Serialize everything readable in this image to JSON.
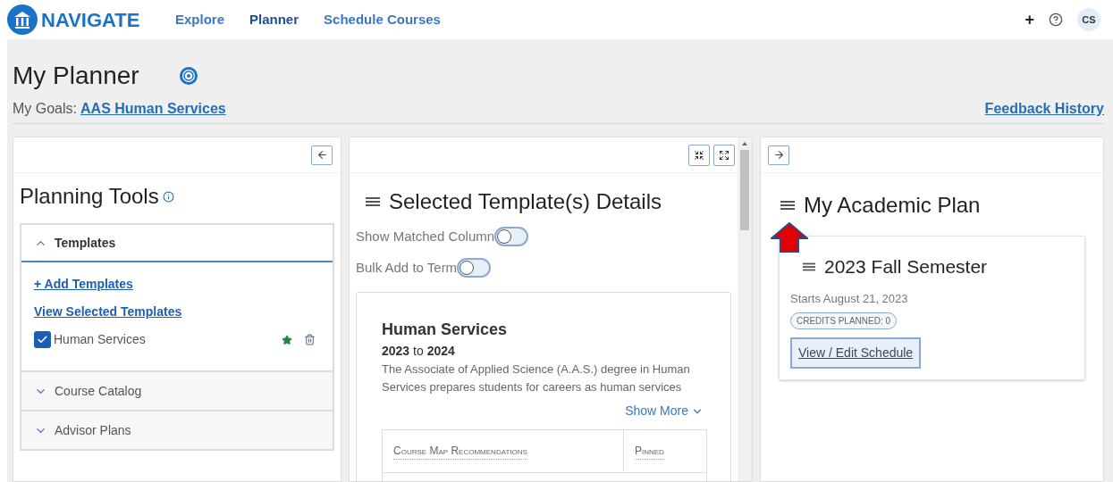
{
  "header": {
    "brand": "NAVIGATE",
    "nav": [
      {
        "label": "Explore",
        "selected": false
      },
      {
        "label": "Planner",
        "selected": true
      },
      {
        "label": "Schedule Courses",
        "selected": false
      }
    ],
    "actions": {
      "add": "+",
      "avatar": "CS"
    }
  },
  "page": {
    "title": "My Planner",
    "goals_label": "My Goals:",
    "goal_link": "AAS Human Services",
    "feedback_link": "Feedback History"
  },
  "planning_tools": {
    "title": "Planning Tools",
    "sections": [
      {
        "label": "Templates",
        "expanded": true,
        "links": [
          "+ Add Templates",
          "View Selected Templates"
        ],
        "templates": [
          {
            "name": "Human Services",
            "checked": true,
            "starred": true
          }
        ]
      },
      {
        "label": "Course Catalog",
        "expanded": false
      },
      {
        "label": "Advisor Plans",
        "expanded": false
      }
    ]
  },
  "template_details": {
    "title": "Selected Template(s) Details",
    "toggles": [
      {
        "label": "Show Matched Column",
        "on": false
      },
      {
        "label": "Bulk Add to Term",
        "on": false
      }
    ],
    "card": {
      "name": "Human Services",
      "years": "**2023** to **2024**",
      "description": "The Associate of Applied Science (A.A.S.) degree in Human",
      "description_2": "Services prepares students for careers as human services",
      "show_more": "Show More",
      "columns": [
        "Course Map Recommendations",
        "Pinned"
      ]
    }
  },
  "academic_plan": {
    "title": "My Academic Plan",
    "terms": [
      {
        "title": "2023 Fall Semester",
        "starts": "Starts August 21, 2023",
        "credits": "CREDITS PLANNED: 0",
        "button": "View / Edit Schedule"
      }
    ]
  }
}
